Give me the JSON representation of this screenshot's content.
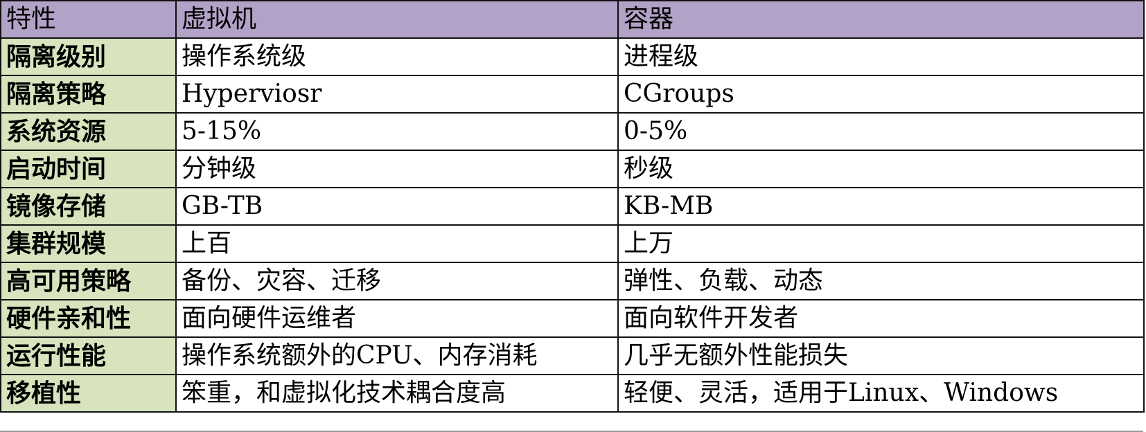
{
  "table": {
    "headers": [
      "特性",
      "虚拟机",
      "容器"
    ],
    "rows": [
      [
        "隔离级别",
        "操作系统级",
        "进程级"
      ],
      [
        "隔离策略",
        "Hyperviosr",
        "CGroups"
      ],
      [
        "系统资源",
        "5-15%",
        "0-5%"
      ],
      [
        "启动时间",
        "分钟级",
        "秒级"
      ],
      [
        "镜像存储",
        "GB-TB",
        "KB-MB"
      ],
      [
        "集群规模",
        "上百",
        "上万"
      ],
      [
        "高可用策略",
        "备份、灾容、迁移",
        "弹性、负载、动态"
      ],
      [
        "硬件亲和性",
        "面向硬件运维者",
        "面向软件开发者"
      ],
      [
        "运行性能",
        "操作系统额外的CPU、内存消耗",
        "几乎无额外性能损失"
      ],
      [
        "移植性",
        "笨重，和虚拟化技术耦合度高",
        "轻便、灵活，适用于Linux、Windows"
      ]
    ]
  },
  "colors": {
    "header_bg": "#b3a2c7",
    "feature_col_bg": "#d7e4bd",
    "cell_bg": "#ffffff",
    "border": "#111111"
  }
}
